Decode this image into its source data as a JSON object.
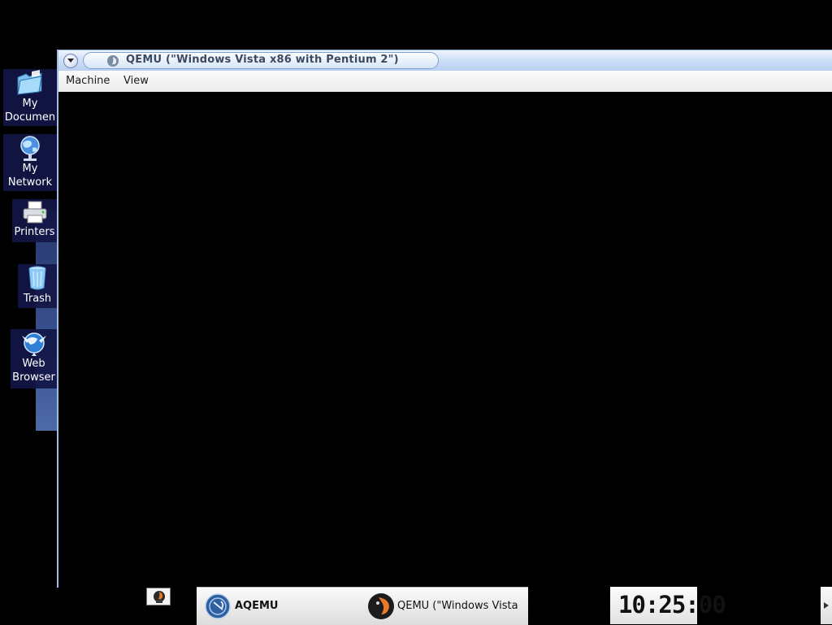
{
  "desktop": {
    "icons": [
      {
        "label_line1": "My",
        "label_line2": "Documen",
        "icon": "folder-icon"
      },
      {
        "label_line1": "My",
        "label_line2": "Network",
        "icon": "network-globe-icon"
      },
      {
        "label_line1": "Printers",
        "icon": "printer-icon"
      },
      {
        "label_line1": "Trash",
        "icon": "trash-icon"
      },
      {
        "label_line1": "Web",
        "label_line2": "Browser",
        "icon": "web-browser-icon"
      }
    ]
  },
  "window": {
    "title": "QEMU (\"Windows Vista x86 with Pentium 2\")",
    "title_icon": "qemu-icon",
    "menu": [
      "Machine",
      "View"
    ]
  },
  "taskbar": {
    "items": [
      {
        "label": "AQEMU",
        "icon": "aqemu-icon"
      },
      {
        "label": "QEMU (\"Windows Vista",
        "icon": "qemu-icon"
      }
    ],
    "clock": "10:25:00"
  },
  "colors": {
    "desktop_bg": "#000000",
    "titlebar_accent": "#b7cff0",
    "icon_bg": "#121646"
  }
}
